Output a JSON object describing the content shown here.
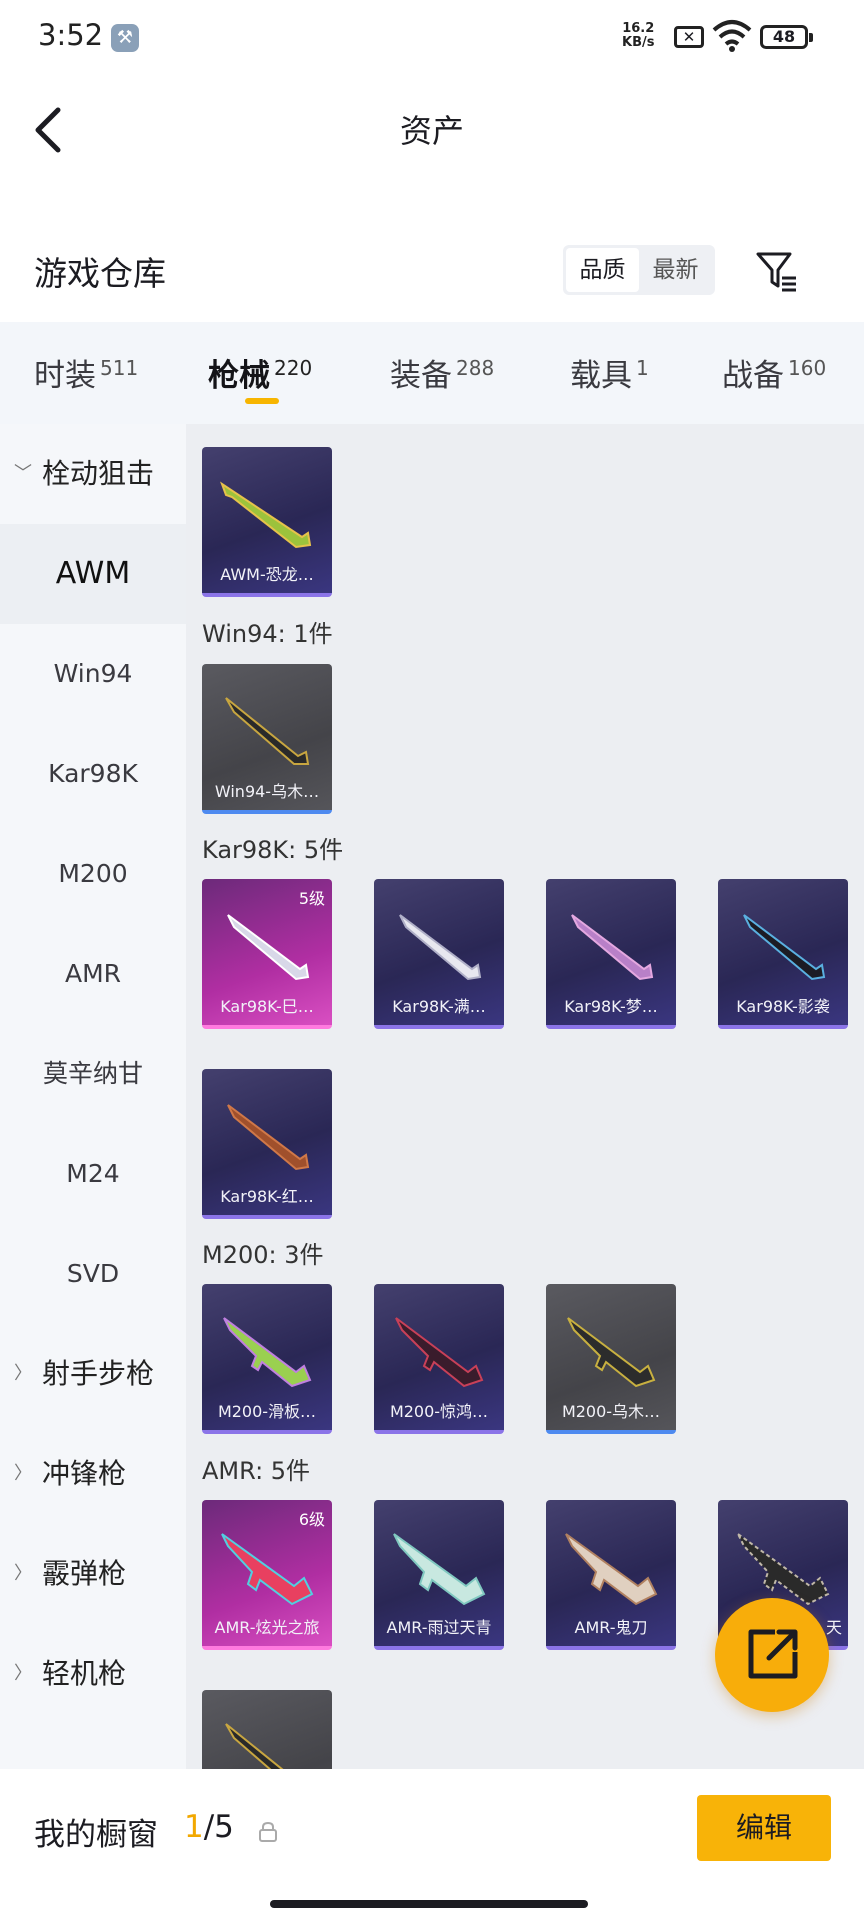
{
  "status_bar": {
    "time": "3:52",
    "speed_value": "16.2",
    "speed_unit": "KB/s",
    "battery": "48"
  },
  "header": {
    "title": "资产"
  },
  "section": {
    "title": "游戏仓库",
    "sort_options": [
      "品质",
      "最新"
    ],
    "active_sort": "品质"
  },
  "tabs": [
    {
      "label": "时装",
      "count": "511"
    },
    {
      "label": "枪械",
      "count": "220"
    },
    {
      "label": "装备",
      "count": "288"
    },
    {
      "label": "载具",
      "count": "1"
    },
    {
      "label": "战备",
      "count": "160"
    }
  ],
  "active_tab": "枪械",
  "sidenav": [
    {
      "label": "栓动狙击",
      "type": "group",
      "expanded": true
    },
    {
      "label": "AWM",
      "type": "item",
      "active": true
    },
    {
      "label": "Win94",
      "type": "item"
    },
    {
      "label": "Kar98K",
      "type": "item"
    },
    {
      "label": "M200",
      "type": "item"
    },
    {
      "label": "AMR",
      "type": "item"
    },
    {
      "label": "莫辛纳甘",
      "type": "item"
    },
    {
      "label": "M24",
      "type": "item"
    },
    {
      "label": "SVD",
      "type": "item"
    },
    {
      "label": "射手步枪",
      "type": "group"
    },
    {
      "label": "冲锋枪",
      "type": "group"
    },
    {
      "label": "霰弹枪",
      "type": "group"
    },
    {
      "label": "轻机枪",
      "type": "group"
    }
  ],
  "groups": [
    {
      "label": "",
      "items": [
        {
          "name": "AWM-恐龙…",
          "rarity": "purple",
          "level": ""
        }
      ]
    },
    {
      "label": "Win94: 1件",
      "items": [
        {
          "name": "Win94-乌木…",
          "rarity": "gray",
          "level": ""
        }
      ]
    },
    {
      "label": "Kar98K: 5件",
      "items": [
        {
          "name": "Kar98K-巳…",
          "rarity": "pink",
          "level": "5级"
        },
        {
          "name": "Kar98K-满…",
          "rarity": "purple",
          "level": ""
        },
        {
          "name": "Kar98K-梦…",
          "rarity": "purple",
          "level": ""
        },
        {
          "name": "Kar98K-影袭",
          "rarity": "purple",
          "level": ""
        },
        {
          "name": "Kar98K-红…",
          "rarity": "purple",
          "level": ""
        }
      ]
    },
    {
      "label": "M200: 3件",
      "items": [
        {
          "name": "M200-滑板…",
          "rarity": "purple",
          "level": ""
        },
        {
          "name": "M200-惊鸿…",
          "rarity": "purple",
          "level": ""
        },
        {
          "name": "M200-乌木…",
          "rarity": "gray",
          "level": ""
        }
      ]
    },
    {
      "label": "AMR: 5件",
      "items": [
        {
          "name": "AMR-炫光之旅",
          "rarity": "pink",
          "level": "6级"
        },
        {
          "name": "AMR-雨过天青",
          "rarity": "purple",
          "level": ""
        },
        {
          "name": "AMR-鬼刀",
          "rarity": "purple",
          "level": ""
        },
        {
          "name": "天",
          "rarity": "purple",
          "level": ""
        },
        {
          "name": "",
          "rarity": "gray",
          "level": ""
        }
      ]
    }
  ],
  "bottom": {
    "window_label": "我的橱窗",
    "window_current": "1",
    "window_total": "/5",
    "edit_label": "编辑"
  },
  "colors": {
    "accent": "#f8b308",
    "rarity_purple": "#8b74e8",
    "rarity_pink": "#ff7adf",
    "rarity_gray": "#4e8af0"
  },
  "icons": [
    "back-arrow-icon",
    "filter-icon",
    "lock-icon",
    "share-icon",
    "wifi-icon",
    "battery-icon",
    "wrench-icon"
  ]
}
